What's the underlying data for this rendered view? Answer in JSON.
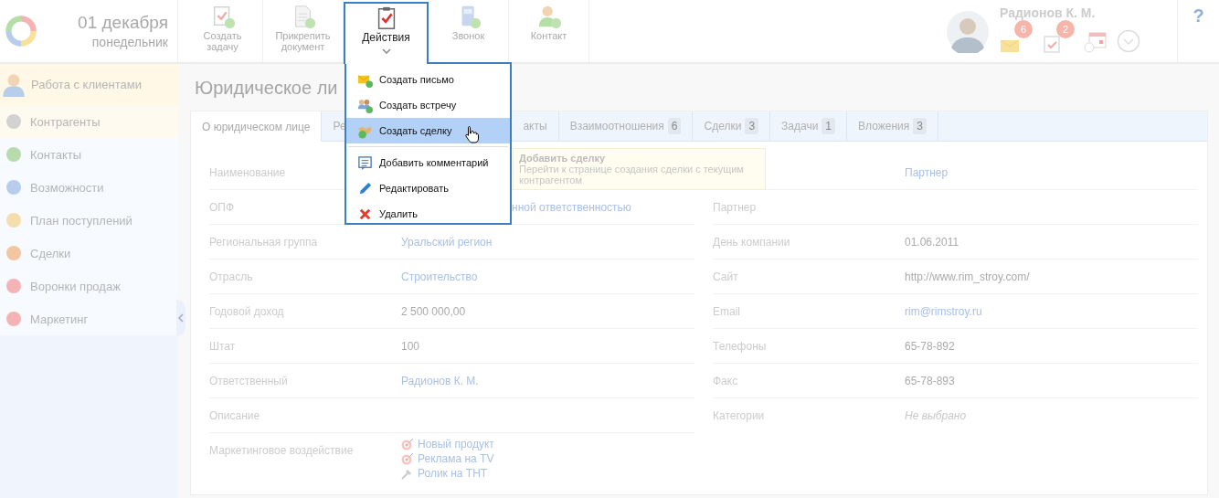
{
  "header": {
    "date": "01 декабря",
    "weekday": "понедельник"
  },
  "toolbar": [
    {
      "label": "Создать задачу",
      "selected": false
    },
    {
      "label": "Прикрепить документ",
      "selected": false
    },
    {
      "label": "Действия",
      "selected": true
    },
    {
      "label": "Звонок",
      "selected": false
    },
    {
      "label": "Контакт",
      "selected": false
    }
  ],
  "user": {
    "name": "Радионов К. М.",
    "badges": [
      {
        "count": "6"
      },
      {
        "count": "2"
      }
    ]
  },
  "help": "?",
  "sidebar": {
    "section": "Работа с клиентами",
    "items": [
      {
        "label": "Контрагенты",
        "selected": true
      },
      {
        "label": "Контакты",
        "selected": false
      },
      {
        "label": "Возможности",
        "selected": false
      },
      {
        "label": "План поступлений",
        "selected": false
      },
      {
        "label": "Сделки",
        "selected": false
      },
      {
        "label": "Воронки продаж",
        "selected": false
      },
      {
        "label": "Маркетинг",
        "selected": false
      }
    ]
  },
  "page_title": "Юридическое ли",
  "tabs": [
    {
      "label": "О юридическом лице",
      "selected": true
    },
    {
      "label": "Ре",
      "selected": false,
      "covered": true
    },
    {
      "label": "акты",
      "selected": false
    },
    {
      "label": "Взаимоотношения",
      "count": "6",
      "selected": false
    },
    {
      "label": "Сделки",
      "count": "3",
      "selected": false
    },
    {
      "label": "Задачи",
      "count": "1",
      "selected": false
    },
    {
      "label": "Вложения",
      "count": "3",
      "selected": false
    }
  ],
  "dropdown": {
    "sections": [
      [
        {
          "label": "Создать письмо",
          "selected": false
        },
        {
          "label": "Создать встречу",
          "selected": false
        },
        {
          "label": "Создать сделку",
          "selected": true
        }
      ],
      [
        {
          "label": "Добавить комментарий",
          "selected": false
        },
        {
          "label": "Редактировать",
          "selected": false
        },
        {
          "label": "Удалить",
          "selected": false
        }
      ]
    ]
  },
  "tooltip": {
    "title": "Добавить сделку",
    "text": "Перейти к странице создания сделки с текущим контрагентом"
  },
  "fields": {
    "left": [
      {
        "label": "Наименование"
      },
      {
        "label": "ОПФ",
        "kind": "covered_link",
        "value": "нной ответственностью"
      },
      {
        "label": "Региональная группа",
        "kind": "link",
        "value": "Уральский регион"
      },
      {
        "label": "Отрасль",
        "kind": "link",
        "value": "Строительство"
      },
      {
        "label": "Годовой доход",
        "kind": "text",
        "value": "2 500 000,00"
      },
      {
        "label": "Штат",
        "kind": "text",
        "value": "100"
      },
      {
        "label": "Ответственный",
        "kind": "link",
        "value": "Радионов К. М."
      },
      {
        "label": "Описание"
      },
      {
        "label": "Маркетинговое воздействие",
        "kind": "links",
        "links": [
          {
            "label": "Новый продукт",
            "kind": "target"
          },
          {
            "label": "Реклама на TV",
            "kind": "target"
          },
          {
            "label": "Ролик на ТНТ",
            "kind": "pin"
          }
        ]
      }
    ],
    "right": [
      {
        "kind": "link",
        "value": "Партнер"
      },
      {
        "label": "Партнер"
      },
      {
        "label": "День компании",
        "kind": "text",
        "value": "01.06.2011"
      },
      {
        "label": "Сайт",
        "kind": "text",
        "value": "http://www.rim_stroy.com/"
      },
      {
        "label": "Email",
        "kind": "link",
        "value": "rim@rimstroy.ru"
      },
      {
        "label": "Телефоны",
        "kind": "text",
        "value": "65-78-892"
      },
      {
        "label": "Факс",
        "kind": "text",
        "value": "65-78-893"
      },
      {
        "label": "Категории",
        "kind": "empty",
        "value": "Не выбрано"
      }
    ]
  }
}
